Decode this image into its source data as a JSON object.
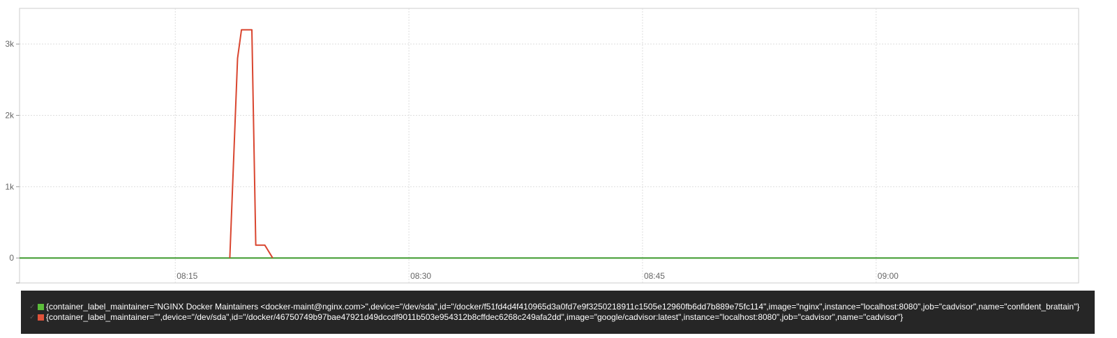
{
  "chart_data": {
    "type": "line",
    "title": "",
    "xlabel": "",
    "ylabel": "",
    "ylim": [
      -350,
      3500
    ],
    "xlim": [
      "08:05",
      "09:13"
    ],
    "x_ticks": [
      {
        "label": "08:15",
        "t": "08:15"
      },
      {
        "label": "08:30",
        "t": "08:30"
      },
      {
        "label": "08:45",
        "t": "08:45"
      },
      {
        "label": "09:00",
        "t": "09:00"
      }
    ],
    "y_ticks": [
      {
        "label": "0",
        "v": 0
      },
      {
        "label": "1k",
        "v": 1000
      },
      {
        "label": "2k",
        "v": 2000
      },
      {
        "label": "3k",
        "v": 3000
      }
    ],
    "grid": true,
    "legend_position": "bottom",
    "series": [
      {
        "name": "{container_label_maintainer=\"NGINX Docker Maintainers <docker-maint@nginx.com>\",device=\"/dev/sda\",id=\"/docker/f51fd4d4f410965d3a0fd7e9f3250218911c1505e12960fb6dd7b889e75fc114\",image=\"nginx\",instance=\"localhost:8080\",job=\"cadvisor\",name=\"confident_brattain\"}",
        "color": "#3f9a2f",
        "points": [
          [
            "08:05",
            0
          ],
          [
            "09:13",
            0
          ]
        ]
      },
      {
        "name": "{container_label_maintainer=\"\",device=\"/dev/sda\",id=\"/docker/46750749b97bae47921d49dccdf9011b503e954312b8cffdec6268c249afa2dd\",image=\"google/cadvisor:latest\",instance=\"localhost:8080\",job=\"cadvisor\",name=\"cadvisor\"}",
        "color": "#d9452f",
        "points": [
          [
            "08:18:30",
            0
          ],
          [
            "08:19:00",
            2800
          ],
          [
            "08:19:15",
            3200
          ],
          [
            "08:19:45",
            3200
          ],
          [
            "08:19:55",
            3200
          ],
          [
            "08:20:10",
            180
          ],
          [
            "08:20:45",
            180
          ],
          [
            "08:21:15",
            0
          ]
        ]
      }
    ]
  }
}
